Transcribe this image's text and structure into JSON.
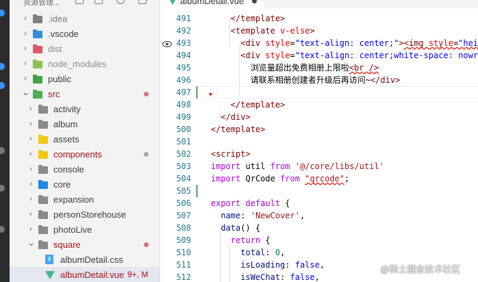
{
  "sidebar": {
    "title": "资源管理...",
    "items": [
      {
        "label": ".idea",
        "type": "folder",
        "color": "#7f7f7f",
        "label_color": "#7a7a7a",
        "expanded": false
      },
      {
        "label": ".vscode",
        "type": "folder",
        "color": "#2f8fd8",
        "label_color": "#3b3b3b",
        "expanded": false
      },
      {
        "label": "dist",
        "type": "folder",
        "color": "#e0566a",
        "label_color": "#8b8b8b",
        "expanded": false
      },
      {
        "label": "node_modules",
        "type": "folder",
        "color": "#8bc34a",
        "label_color": "#8b8b8b",
        "expanded": false
      },
      {
        "label": "public",
        "type": "folder",
        "color": "#43a047",
        "label_color": "#3b3b3b",
        "expanded": false
      },
      {
        "label": "src",
        "type": "folder",
        "color": "#4caf50",
        "label_color": "#a31515",
        "expanded": true,
        "dot": "#d9707a"
      },
      {
        "label": "activity",
        "type": "folder",
        "color": "#8a8a8a",
        "label_color": "#3b3b3b",
        "expanded": false
      },
      {
        "label": "album",
        "type": "folder",
        "color": "#8a8a8a",
        "label_color": "#3b3b3b",
        "expanded": false
      },
      {
        "label": "assets",
        "type": "folder",
        "color": "#f2c811",
        "label_color": "#3b3b3b",
        "expanded": false
      },
      {
        "label": "components",
        "type": "folder",
        "color": "#f2c811",
        "label_color": "#a31515",
        "expanded": false,
        "dot": "#a8a8a8"
      },
      {
        "label": "console",
        "type": "folder",
        "color": "#8a8a8a",
        "label_color": "#3b3b3b",
        "expanded": false
      },
      {
        "label": "core",
        "type": "folder",
        "color": "#1e88e5",
        "label_color": "#3b3b3b",
        "expanded": false
      },
      {
        "label": "expansion",
        "type": "folder",
        "color": "#8a8a8a",
        "label_color": "#3b3b3b",
        "expanded": false
      },
      {
        "label": "personStorehouse",
        "type": "folder",
        "color": "#8a8a8a",
        "label_color": "#3b3b3b",
        "expanded": false
      },
      {
        "label": "photoLive",
        "type": "folder",
        "color": "#8a8a8a",
        "label_color": "#3b3b3b",
        "expanded": false
      },
      {
        "label": "square",
        "type": "folder",
        "color": "#8a8a8a",
        "label_color": "#a31515",
        "expanded": true,
        "dot": "#d9707a"
      },
      {
        "label": "albumDetail.css",
        "type": "css",
        "color": "#42a5f5",
        "label_color": "#3b3b3b"
      },
      {
        "label": "albumDetail.vue",
        "type": "vue",
        "color": "#41b883",
        "label_color": "#a31515",
        "badge": "9+, M"
      }
    ]
  },
  "tab": {
    "label": "albumDetail.vue"
  },
  "editor": {
    "lines": [
      {
        "num": "491",
        "parts": [
          [
            "        ",
            ""
          ],
          [
            "</template>",
            "t-tag"
          ]
        ]
      },
      {
        "num": "492",
        "parts": [
          [
            "        ",
            ""
          ],
          [
            "<template ",
            "t-tag"
          ],
          [
            "v-else",
            "t-attr"
          ],
          [
            ">",
            "t-tag"
          ]
        ]
      },
      {
        "num": "493",
        "parts": [
          [
            "          ",
            ""
          ],
          [
            "<div ",
            "t-tag"
          ],
          [
            "style",
            "t-attr"
          ],
          [
            "=",
            "t-text"
          ],
          [
            "\"text-align: center;\"",
            "t-str"
          ],
          [
            ">",
            "t-tag"
          ],
          [
            "<img ",
            "t-tag sq"
          ],
          [
            "style",
            "t-attr sq"
          ],
          [
            "=",
            "t-text sq"
          ],
          [
            "\"hei",
            "t-str sq"
          ]
        ]
      },
      {
        "num": "494",
        "parts": [
          [
            "          ",
            ""
          ],
          [
            "<div ",
            "t-tag"
          ],
          [
            "style",
            "t-attr"
          ],
          [
            "=",
            "t-text"
          ],
          [
            "\"text-align: center;white-space: nowr",
            "t-str"
          ]
        ]
      },
      {
        "num": "495",
        "parts": [
          [
            "            ",
            ""
          ],
          [
            "浏览量超出免费相册上限啦",
            "t-text"
          ],
          [
            "<br />",
            "t-tag sq"
          ]
        ]
      },
      {
        "num": "496",
        "parts": [
          [
            "            ",
            ""
          ],
          [
            "请联系相册创建者升级后再访问~",
            "t-text"
          ],
          [
            "</div>",
            "t-tag"
          ]
        ]
      },
      {
        "num": "497",
        "parts": []
      },
      {
        "num": "498",
        "parts": [
          [
            "        ",
            ""
          ],
          [
            "</template>",
            "t-tag"
          ]
        ]
      },
      {
        "num": "499",
        "parts": [
          [
            "      ",
            ""
          ],
          [
            "</div>",
            "t-tag"
          ]
        ]
      },
      {
        "num": "500",
        "parts": [
          [
            "    ",
            ""
          ],
          [
            "</template>",
            "t-tag"
          ]
        ]
      },
      {
        "num": "501",
        "parts": []
      },
      {
        "num": "502",
        "parts": [
          [
            "    ",
            ""
          ],
          [
            "<script>",
            "t-tag"
          ]
        ]
      },
      {
        "num": "503",
        "parts": [
          [
            "    ",
            ""
          ],
          [
            "import",
            "t-kw2"
          ],
          [
            " util ",
            "t-text"
          ],
          [
            "from",
            "t-kw2"
          ],
          [
            " ",
            ""
          ],
          [
            "'@/core/libs/util'",
            "t-jsstr"
          ]
        ]
      },
      {
        "num": "504",
        "parts": [
          [
            "    ",
            ""
          ],
          [
            "import",
            "t-kw2"
          ],
          [
            " QrCode ",
            "t-text"
          ],
          [
            "from",
            "t-kw2"
          ],
          [
            " ",
            ""
          ],
          [
            "\"qrcode\"",
            "t-jsstr sq"
          ],
          [
            ";",
            "t-text"
          ]
        ]
      },
      {
        "num": "505",
        "parts": []
      },
      {
        "num": "506",
        "parts": [
          [
            "    ",
            ""
          ],
          [
            "export",
            "t-kw2"
          ],
          [
            " ",
            ""
          ],
          [
            "default",
            "t-kw2"
          ],
          [
            " {",
            "t-text"
          ]
        ]
      },
      {
        "num": "507",
        "parts": [
          [
            "      ",
            ""
          ],
          [
            "name",
            "t-prop"
          ],
          [
            ": ",
            "t-text"
          ],
          [
            "'NewCover'",
            "t-jsstr"
          ],
          [
            ",",
            "t-text"
          ]
        ]
      },
      {
        "num": "508",
        "parts": [
          [
            "      ",
            ""
          ],
          [
            "data",
            "t-prop"
          ],
          [
            "() {",
            "t-text"
          ]
        ]
      },
      {
        "num": "509",
        "parts": [
          [
            "        ",
            ""
          ],
          [
            "return",
            "t-kw2"
          ],
          [
            " {",
            "t-text"
          ]
        ]
      },
      {
        "num": "510",
        "parts": [
          [
            "          ",
            ""
          ],
          [
            "total",
            "t-prop"
          ],
          [
            ": ",
            "t-text"
          ],
          [
            "0",
            "t-num"
          ],
          [
            ",",
            "t-text"
          ]
        ]
      },
      {
        "num": "511",
        "parts": [
          [
            "          ",
            ""
          ],
          [
            "isLoading",
            "t-prop"
          ],
          [
            ": ",
            "t-text"
          ],
          [
            "false",
            "t-kw"
          ],
          [
            ",",
            "t-text"
          ]
        ]
      },
      {
        "num": "512",
        "parts": [
          [
            "          ",
            ""
          ],
          [
            "isWeChat",
            "t-prop"
          ],
          [
            ": ",
            "t-text"
          ],
          [
            "false",
            "t-kw"
          ],
          [
            ",",
            "t-text"
          ]
        ]
      }
    ]
  },
  "watermark": "@稀土掘金技术社区"
}
